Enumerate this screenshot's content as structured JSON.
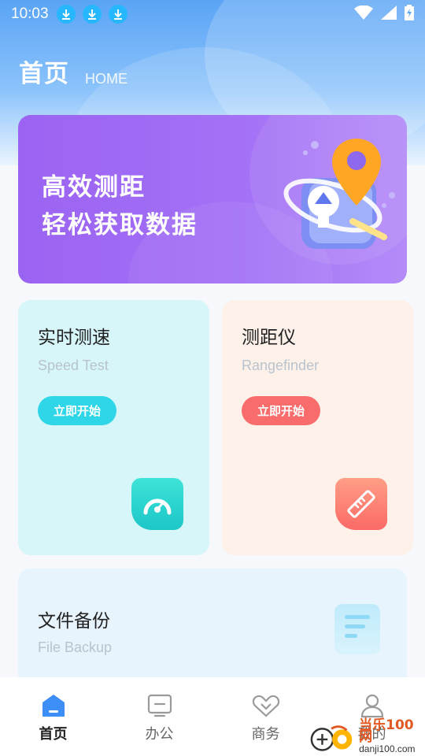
{
  "status_bar": {
    "time": "10:03",
    "download_icons": [
      "download-icon",
      "download-icon",
      "download-icon"
    ],
    "right_icons": [
      "wifi-icon",
      "signal-icon",
      "battery-charging-icon"
    ]
  },
  "header": {
    "title": "首页",
    "subtitle": "HOME"
  },
  "banner": {
    "line1": "高效测距",
    "line2": "轻松获取数据",
    "illustration": "map-location-pin-icon"
  },
  "cards": [
    {
      "title": "实时测速",
      "subtitle": "Speed Test",
      "button": "立即开始",
      "icon": "speedometer-icon",
      "accent": "#2ed6e8"
    },
    {
      "title": "测距仪",
      "subtitle": "Rangefinder",
      "button": "立即开始",
      "icon": "ruler-icon",
      "accent": "#f96c6c"
    },
    {
      "title": "文件备份",
      "subtitle": "File Backup",
      "icon": "document-icon"
    }
  ],
  "tabbar": {
    "items": [
      {
        "label": "首页",
        "icon": "home-icon",
        "active": true
      },
      {
        "label": "办公",
        "icon": "monitor-icon",
        "active": false
      },
      {
        "label": "商务",
        "icon": "handshake-icon",
        "active": false
      },
      {
        "label": "我的",
        "icon": "user-icon",
        "active": false
      }
    ]
  },
  "watermark": {
    "line1": "当乐100网",
    "line2": "danji100.com"
  }
}
